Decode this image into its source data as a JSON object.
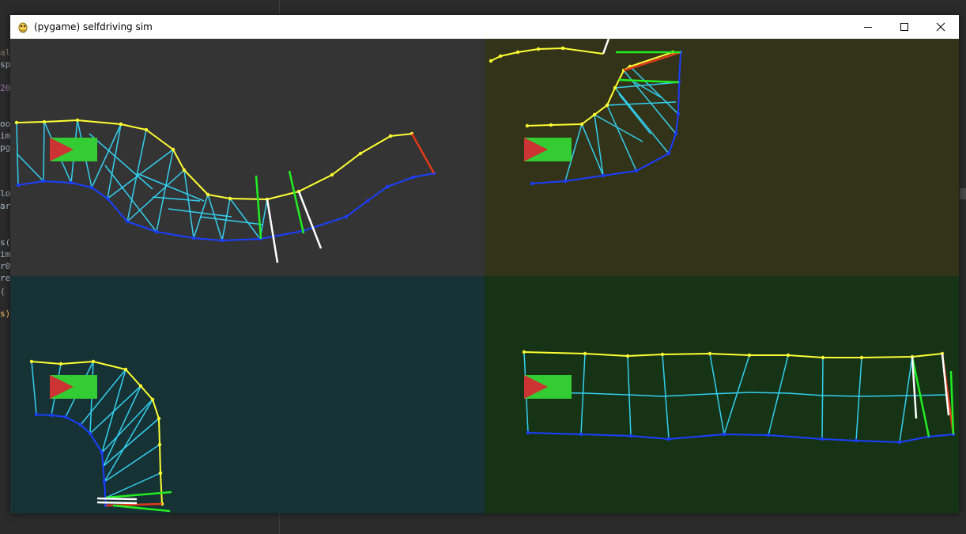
{
  "window": {
    "title": "(pygame) selfdriving sim"
  },
  "colors": {
    "pane_top_left": "#343434",
    "pane_top_right": "#333319",
    "pane_bottom_left": "#163234",
    "pane_bottom_right": "#163316",
    "left_border": "#ffff33",
    "right_border": "#1a3fff",
    "cross_lines": "#33d0f0",
    "finish": "#e03a1a",
    "sensor_green": "#22ee22",
    "sensor_white": "#ffffff",
    "car_body": "#33cc33",
    "car_arrow": "#cc3333"
  },
  "editor": {
    "code_fragments": [
      "al",
      "sp",
      "20",
      "oo",
      "im",
      "pg",
      "lo",
      "ar",
      "s(",
      "im",
      "r0",
      "re",
      " (",
      "s)"
    ]
  }
}
